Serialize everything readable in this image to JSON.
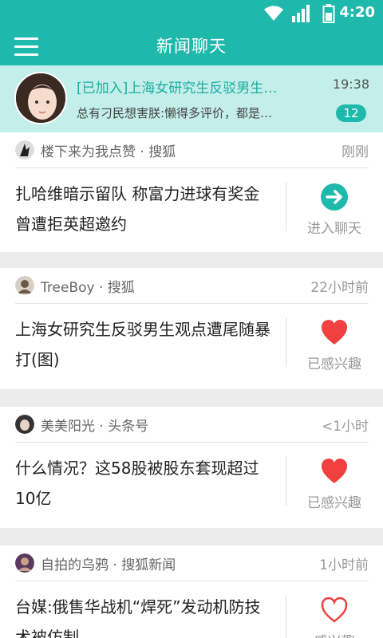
{
  "status_bar": {
    "time": "4:20"
  },
  "app_bar": {
    "title": "新闻聊天"
  },
  "chat_banner": {
    "title": "[已加入]上海女研究生反驳男生…",
    "last_message": "总有刁民想害朕:懒得多评价，都是…",
    "time": "19:38",
    "unread": "12"
  },
  "feed": [
    {
      "source": "楼下来为我点赞 · 搜狐",
      "age": "刚刚",
      "headline": "扎哈维暗示留队 称富力进球有奖金曾遭拒英超邀约",
      "action_label": "进入聊天",
      "action_icon": "arrow-right-circle-icon"
    },
    {
      "source": "TreeBoy · 搜狐",
      "age": "22小时前",
      "headline": "上海女研究生反驳男生观点遭尾随暴打(图)",
      "action_label": "已感兴趣",
      "action_icon": "heart-filled-icon"
    },
    {
      "source": "美美阳光 · 头条号",
      "age": "<1小时",
      "headline": "什么情况？这58股被股东套现超过10亿",
      "action_label": "已感兴趣",
      "action_icon": "heart-filled-icon"
    },
    {
      "source": "自拍的乌鸦 · 搜狐新闻",
      "age": "1小时前",
      "headline": "台媒:俄售华战机“焊死”发动机防技术被仿制",
      "action_label": "感兴趣",
      "action_icon": "heart-outline-icon"
    }
  ],
  "colors": {
    "accent": "#1fb9ab",
    "heart": "#f04040"
  }
}
